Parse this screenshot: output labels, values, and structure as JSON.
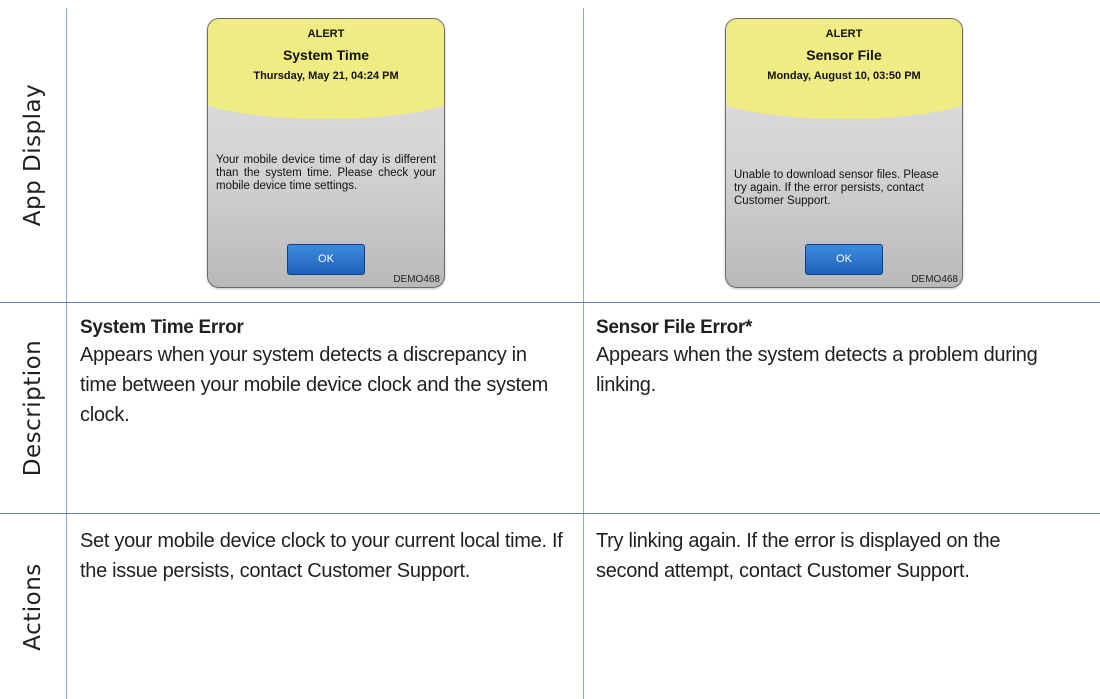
{
  "rows": {
    "app_display": "App Display",
    "description": "Description",
    "actions": "Actions"
  },
  "columns": [
    {
      "alert": {
        "label": "ALERT",
        "subject": "System Time",
        "date": "Thursday, May 21, 04:24 PM",
        "message": "Your mobile device time of day is different than the system time. Please check your mobile device time settings.",
        "button": "OK",
        "tag": "DEMO468"
      },
      "description_title": "System Time Error",
      "description_text": "Appears when your system detects a discrepancy in time between your mobile device clock and the system clock.",
      "actions_text": "Set your mobile device clock to your current local time. If the issue persists, contact Customer Support."
    },
    {
      "alert": {
        "label": "ALERT",
        "subject": "Sensor File",
        "date": "Monday, August 10, 03:50 PM",
        "message": "Unable to download sensor files. Please try again. If the error persists, contact Customer Support.",
        "button": "OK",
        "tag": "DEMO468"
      },
      "description_title": "Sensor File Error*",
      "description_text": "Appears when the system detects a problem during linking.",
      "actions_text": "Try linking again. If the error is displayed on the second attempt, contact Customer Support."
    }
  ]
}
